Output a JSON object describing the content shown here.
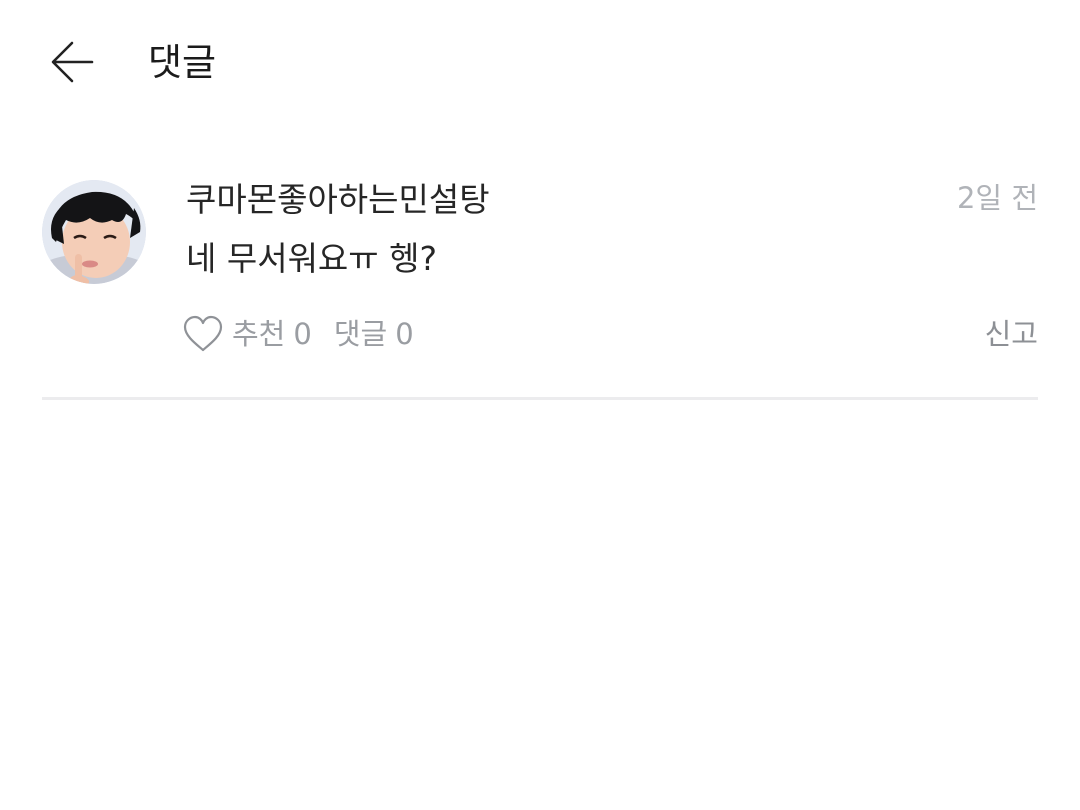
{
  "header": {
    "title": "댓글",
    "back_icon": "arrow-left-icon"
  },
  "comment": {
    "author": "쿠마몬좋아하는민설탕",
    "time": "2일 전",
    "text": "네 무서워요ㅠ 헹?",
    "like_icon": "heart-outline-icon",
    "like_label": "추천",
    "like_count": "0",
    "reply_label": "댓글",
    "reply_count": "0",
    "report_label": "신고"
  },
  "colors": {
    "text_primary": "#262626",
    "text_secondary": "#9a9da2",
    "timestamp": "#b0b3b8",
    "divider": "#ececee"
  }
}
